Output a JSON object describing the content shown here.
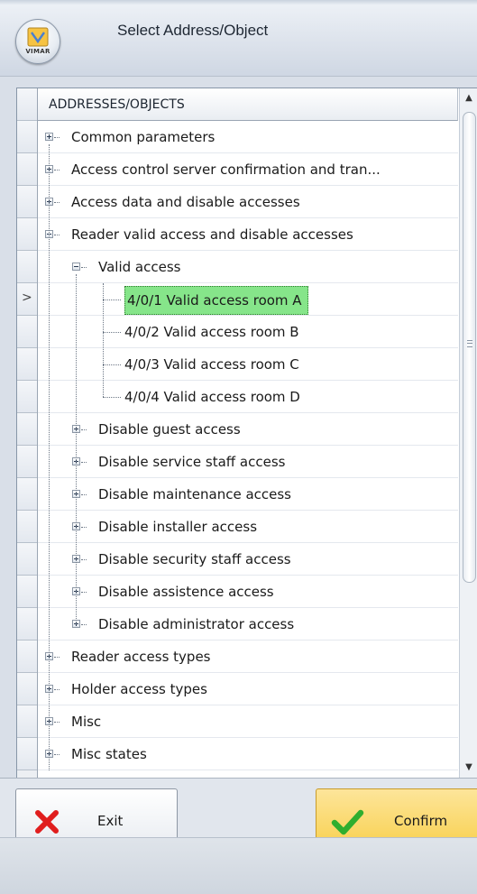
{
  "window": {
    "title": "Select Address/Object",
    "brand": "VIMAR"
  },
  "grid": {
    "column_header": "ADDRESSES/OBJECTS",
    "current_row_indicator": ">",
    "rows": [
      {
        "label": "Common parameters",
        "level": 0,
        "toggle": "plus"
      },
      {
        "label": "Access control server confirmation and tran...",
        "level": 0,
        "toggle": "plus"
      },
      {
        "label": "Access data and disable accesses",
        "level": 0,
        "toggle": "plus"
      },
      {
        "label": "Reader valid access and disable accesses",
        "level": 0,
        "toggle": "minus"
      },
      {
        "label": "Valid access",
        "level": 1,
        "toggle": "minus"
      },
      {
        "label": "4/0/1 Valid access room A",
        "level": 2,
        "toggle": "none",
        "selected": true
      },
      {
        "label": "4/0/2 Valid access room B",
        "level": 2,
        "toggle": "none"
      },
      {
        "label": "4/0/3 Valid access room C",
        "level": 2,
        "toggle": "none"
      },
      {
        "label": "4/0/4 Valid access room D",
        "level": 2,
        "toggle": "none"
      },
      {
        "label": "Disable guest access",
        "level": 1,
        "toggle": "plus"
      },
      {
        "label": "Disable service staff access",
        "level": 1,
        "toggle": "plus"
      },
      {
        "label": "Disable maintenance access",
        "level": 1,
        "toggle": "plus"
      },
      {
        "label": "Disable installer access",
        "level": 1,
        "toggle": "plus"
      },
      {
        "label": "Disable security staff access",
        "level": 1,
        "toggle": "plus"
      },
      {
        "label": "Disable assistence access",
        "level": 1,
        "toggle": "plus"
      },
      {
        "label": "Disable administrator access",
        "level": 1,
        "toggle": "plus"
      },
      {
        "label": "Reader access types",
        "level": 0,
        "toggle": "plus"
      },
      {
        "label": "Holder access types",
        "level": 0,
        "toggle": "plus"
      },
      {
        "label": "Misc",
        "level": 0,
        "toggle": "plus"
      },
      {
        "label": "Misc states",
        "level": 0,
        "toggle": "plus"
      }
    ]
  },
  "buttons": {
    "exit": {
      "label": "Exit",
      "icon": "red-x-icon",
      "color": "#e01e1e"
    },
    "confirm": {
      "label": "Confirm",
      "icon": "green-check-icon",
      "color": "#2fae2f"
    }
  },
  "colors": {
    "selected_row": "#86e58a",
    "confirm_button": "#f8cf4a"
  }
}
